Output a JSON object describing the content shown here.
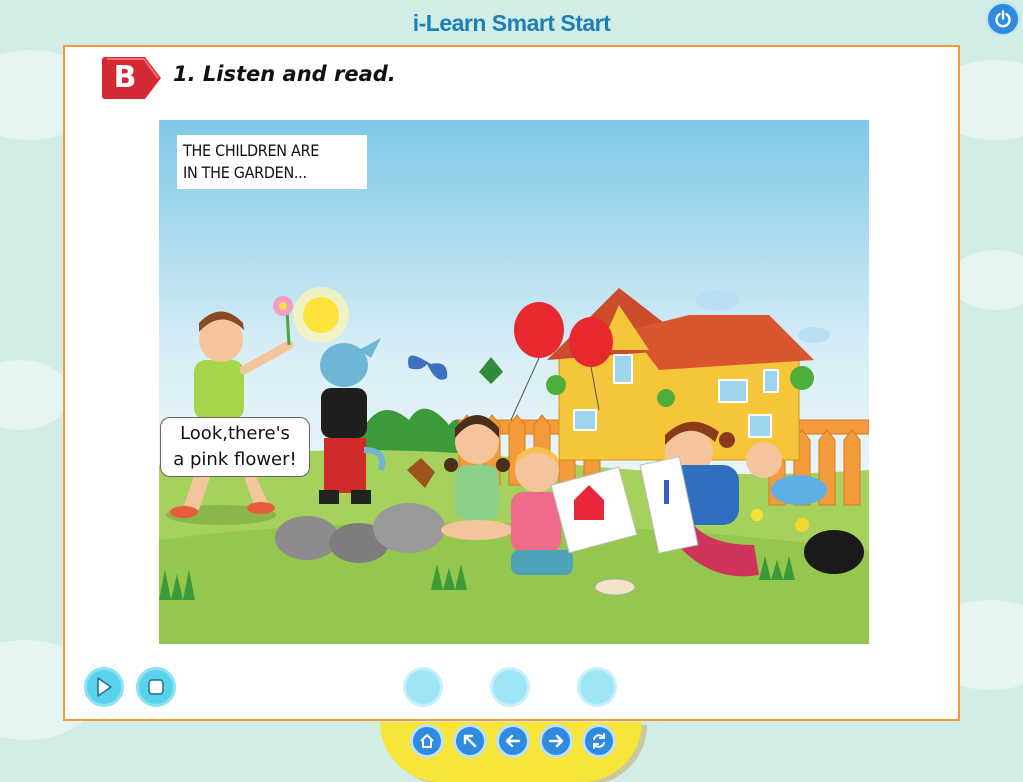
{
  "app": {
    "title": "i-Learn Smart Start"
  },
  "header": {
    "power_icon": "power-icon"
  },
  "lesson": {
    "badge_letter": "B",
    "instruction": "1. Listen and read."
  },
  "scene": {
    "caption_line1": "THE CHILDREN ARE",
    "caption_line2": "IN THE GARDEN...",
    "speech_line1": "Look,there's",
    "speech_line2": "a pink flower!"
  },
  "controls": {
    "play_icon": "play-icon",
    "stop_icon": "stop-icon",
    "dot_buttons": [
      "dot-1",
      "dot-2",
      "dot-3"
    ]
  },
  "nav": {
    "buttons": [
      "home-icon",
      "back-arrow-icon",
      "previous-icon",
      "next-icon",
      "replay-icon"
    ]
  },
  "colors": {
    "accent": "#2f8be0",
    "panel_border": "#f29a3a",
    "badge": "#d42832",
    "dock": "#f7e53a"
  }
}
